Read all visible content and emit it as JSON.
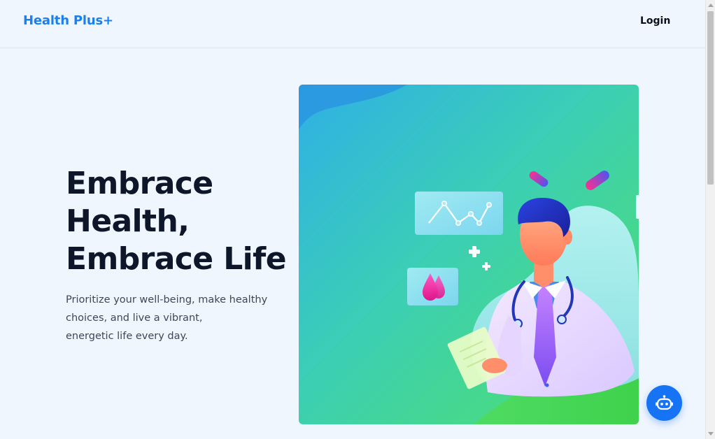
{
  "header": {
    "brand": "Health Plus+",
    "login_label": "Login"
  },
  "hero": {
    "title_lines": [
      "Embrace",
      "Health,",
      "Embrace Life"
    ],
    "text_lines": [
      "Prioritize your well-being, make healthy",
      "choices, and live a vibrant,",
      "energetic life every day."
    ]
  },
  "colors": {
    "brand": "#1a7ff0",
    "background": "#f0f6fe",
    "title": "#0e1629",
    "chatbot": "#1673f4"
  },
  "icons": {
    "chatbot": "robot-icon",
    "illustration": "doctor-illustration"
  }
}
